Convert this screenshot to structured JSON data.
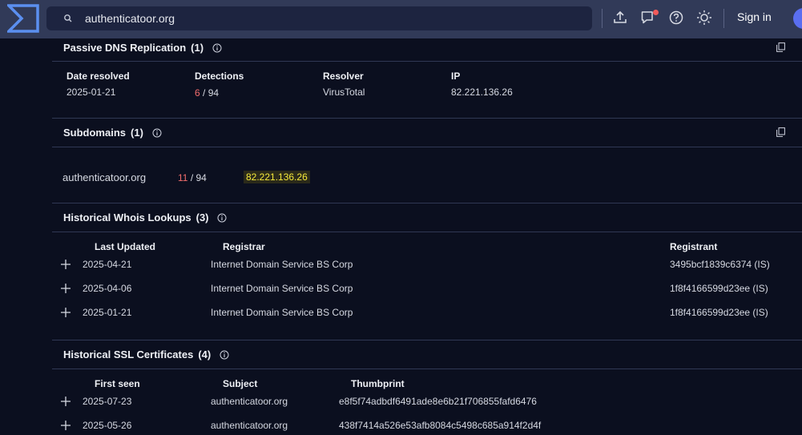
{
  "search": {
    "value": "authenticatoor.org"
  },
  "topbar": {
    "signin_label": "Sign in"
  },
  "passive_dns": {
    "title": "Passive DNS Replication",
    "count": "(1)",
    "headers": [
      "Date resolved",
      "Detections",
      "Resolver",
      "IP"
    ],
    "rows": [
      {
        "date": "2025-01-21",
        "detections_pos": "6",
        "detections_total": "/ 94",
        "resolver": "VirusTotal",
        "ip": "82.221.136.26"
      }
    ]
  },
  "subdomains": {
    "title": "Subdomains",
    "count": "(1)",
    "rows": [
      {
        "domain": "authenticatoor.org",
        "detections_pos": "11",
        "detections_total": "/ 94",
        "ip": "82.221.136.26"
      }
    ]
  },
  "whois": {
    "title": "Historical Whois Lookups",
    "count": "(3)",
    "headers": [
      "Last Updated",
      "Registrar",
      "Registrant"
    ],
    "rows": [
      {
        "date": "2025-04-21",
        "registrar": "Internet Domain Service BS Corp",
        "registrant": "3495bcf1839c6374 (IS)"
      },
      {
        "date": "2025-04-06",
        "registrar": "Internet Domain Service BS Corp",
        "registrant": "1f8f4166599d23ee (IS)"
      },
      {
        "date": "2025-01-21",
        "registrar": "Internet Domain Service BS Corp",
        "registrant": "1f8f4166599d23ee (IS)"
      }
    ]
  },
  "ssl": {
    "title": "Historical SSL Certificates",
    "count": "(4)",
    "headers": [
      "First seen",
      "Subject",
      "Thumbprint"
    ],
    "rows": [
      {
        "date": "2025-07-23",
        "subject": "authenticatoor.org",
        "thumbprint": "e8f5f74adbdf6491ade8e6b21f706855fafd6476"
      },
      {
        "date": "2025-05-26",
        "subject": "authenticatoor.org",
        "thumbprint": "438f7414a526e53afb8084c5498c685a914f2d4f"
      }
    ]
  }
}
